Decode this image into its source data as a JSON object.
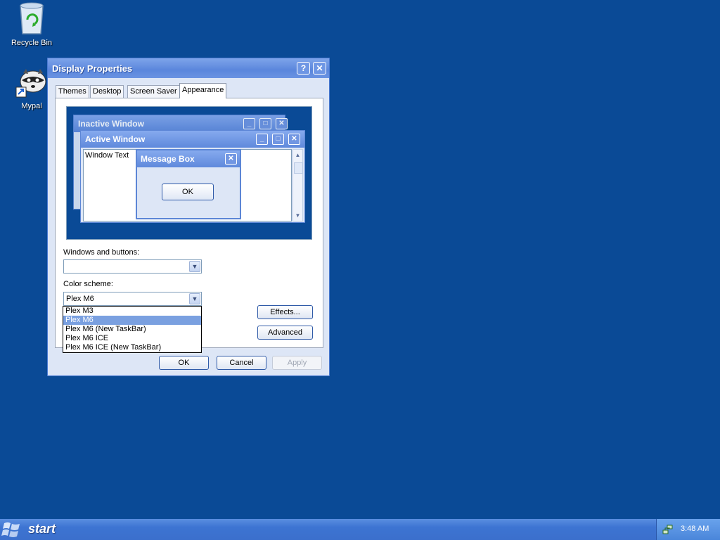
{
  "desktop": {
    "icons": [
      {
        "label": "Recycle Bin",
        "icon": "recycle-bin-icon"
      },
      {
        "label": "Mypal",
        "icon": "mypal-browser-icon"
      }
    ]
  },
  "dialog": {
    "title": "Display Properties",
    "help_label": "?",
    "close_label": "✕",
    "tabs": [
      {
        "label": "Themes"
      },
      {
        "label": "Desktop"
      },
      {
        "label": "Screen Saver"
      },
      {
        "label": "Appearance"
      }
    ],
    "active_tab": "Appearance",
    "preview": {
      "inactive_title": "Inactive Window",
      "active_title": "Active Window",
      "window_text": "Window Text",
      "msgbox_title": "Message Box",
      "msgbox_ok": "OK"
    },
    "windows_buttons": {
      "label": "Windows and buttons:",
      "value": ""
    },
    "color_scheme": {
      "label": "Color scheme:",
      "value": "Plex M6",
      "options": [
        "Plex M3",
        "Plex M6",
        "Plex M6 (New TaskBar)",
        "Plex M6 ICE",
        "Plex M6 ICE (New TaskBar)"
      ],
      "highlighted": "Plex M6"
    },
    "effects_label": "Effects...",
    "advanced_label": "Advanced",
    "ok_label": "OK",
    "cancel_label": "Cancel",
    "apply_label": "Apply"
  },
  "taskbar": {
    "start_label": "start",
    "clock": "3:48 AM"
  },
  "colors": {
    "desktop": "#0a4a96",
    "titlebar": "#5a86dc",
    "selection": "#7aa0e0"
  }
}
